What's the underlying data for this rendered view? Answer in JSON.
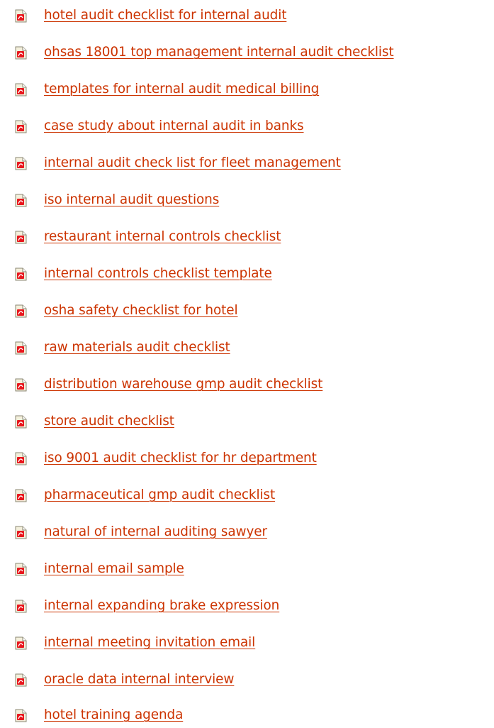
{
  "links": [
    {
      "text": "hotel audit checklist for internal audit",
      "icon": "pdf-file-icon"
    },
    {
      "text": "ohsas 18001 top management internal audit checklist",
      "icon": "pdf-file-icon"
    },
    {
      "text": "templates for internal audit medical billing",
      "icon": "pdf-file-icon"
    },
    {
      "text": "case study about internal audit in banks",
      "icon": "pdf-file-icon"
    },
    {
      "text": "internal audit check list for fleet management",
      "icon": "pdf-file-icon"
    },
    {
      "text": "iso internal audit questions",
      "icon": "pdf-file-icon"
    },
    {
      "text": "restaurant internal controls checklist",
      "icon": "pdf-file-icon"
    },
    {
      "text": "internal controls checklist template",
      "icon": "pdf-file-icon"
    },
    {
      "text": "osha safety checklist for hotel",
      "icon": "pdf-file-icon"
    },
    {
      "text": "raw materials audit checklist",
      "icon": "pdf-file-icon"
    },
    {
      "text": "distribution warehouse gmp audit checklist",
      "icon": "pdf-file-icon"
    },
    {
      "text": "store audit checklist",
      "icon": "pdf-file-icon"
    },
    {
      "text": "iso 9001 audit checklist for hr department",
      "icon": "pdf-file-icon"
    },
    {
      "text": "pharmaceutical gmp audit checklist",
      "icon": "pdf-file-icon"
    },
    {
      "text": "natural of internal auditing sawyer",
      "icon": "pdf-file-icon"
    },
    {
      "text": "internal email sample",
      "icon": "pdf-file-icon"
    },
    {
      "text": "internal expanding brake expression",
      "icon": "pdf-file-icon"
    },
    {
      "text": "internal meeting invitation email",
      "icon": "pdf-file-icon"
    },
    {
      "text": "oracle data internal interview",
      "icon": "pdf-file-icon"
    },
    {
      "text": "hotel training agenda",
      "icon": "pdf-file-icon"
    }
  ],
  "colors": {
    "link": "#cc3300",
    "icon_red": "#e8171d",
    "icon_page": "#f4f0dc"
  }
}
